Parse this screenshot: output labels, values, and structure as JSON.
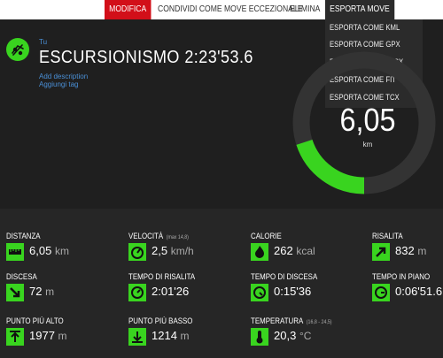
{
  "toolbar": {
    "edit": "MODIFICA",
    "share": "CONDIVIDI COME MOVE ECCEZIONALE",
    "delete": "ELIMINA",
    "export": "ESPORTA MOVE"
  },
  "export_menu": [
    "ESPORTA COME KML",
    "ESPORTA COME GPX",
    "ESPORTA COME XLSX",
    "ESPORTA COME FIT",
    "ESPORTA COME TCX"
  ],
  "header": {
    "user_label": "Tu",
    "title": "ESCURSIONISMO 2:23'53.6",
    "add_description": "Add description",
    "add_tag": "Aggiungi tag"
  },
  "gauge": {
    "value": "6,05",
    "unit": "km",
    "progress": 0.2
  },
  "stats": [
    {
      "label": "DISTANZA",
      "sub": "",
      "value": "6,05",
      "unit": "km",
      "icon": "ruler-icon"
    },
    {
      "label": "VELOCITÀ",
      "sub": "(max 14,8)",
      "value": "2,5",
      "unit": "km/h",
      "icon": "speedometer-icon"
    },
    {
      "label": "CALORIE",
      "sub": "",
      "value": "262",
      "unit": "kcal",
      "icon": "flame-icon"
    },
    {
      "label": "RISALITA",
      "sub": "",
      "value": "832",
      "unit": "m",
      "icon": "arrow-up-right-icon"
    },
    {
      "label": "DISCESA",
      "sub": "",
      "value": "72",
      "unit": "m",
      "icon": "arrow-down-right-icon"
    },
    {
      "label": "TEMPO DI RISALITA",
      "sub": "",
      "value": "2:01'26",
      "unit": "",
      "icon": "clock-up-icon"
    },
    {
      "label": "TEMPO DI DISCESA",
      "sub": "",
      "value": "0:15'36",
      "unit": "",
      "icon": "clock-down-icon"
    },
    {
      "label": "TEMPO IN PIANO",
      "sub": "",
      "value": "0:06'51.6",
      "unit": "",
      "icon": "clock-flat-icon"
    },
    {
      "label": "PUNTO PIÙ ALTO",
      "sub": "",
      "value": "1977",
      "unit": "m",
      "icon": "highest-point-icon"
    },
    {
      "label": "PUNTO PIÙ BASSO",
      "sub": "",
      "value": "1214",
      "unit": "m",
      "icon": "lowest-point-icon"
    },
    {
      "label": "TEMPERATURA",
      "sub": "(16,8 - 24,5)",
      "value": "20,3",
      "unit": "°C",
      "icon": "thermometer-icon"
    }
  ],
  "colors": {
    "accent": "#39d41f",
    "edit_bg": "#d20f19",
    "menu_bg": "#2b2b2b",
    "link": "#4a8fd6"
  }
}
